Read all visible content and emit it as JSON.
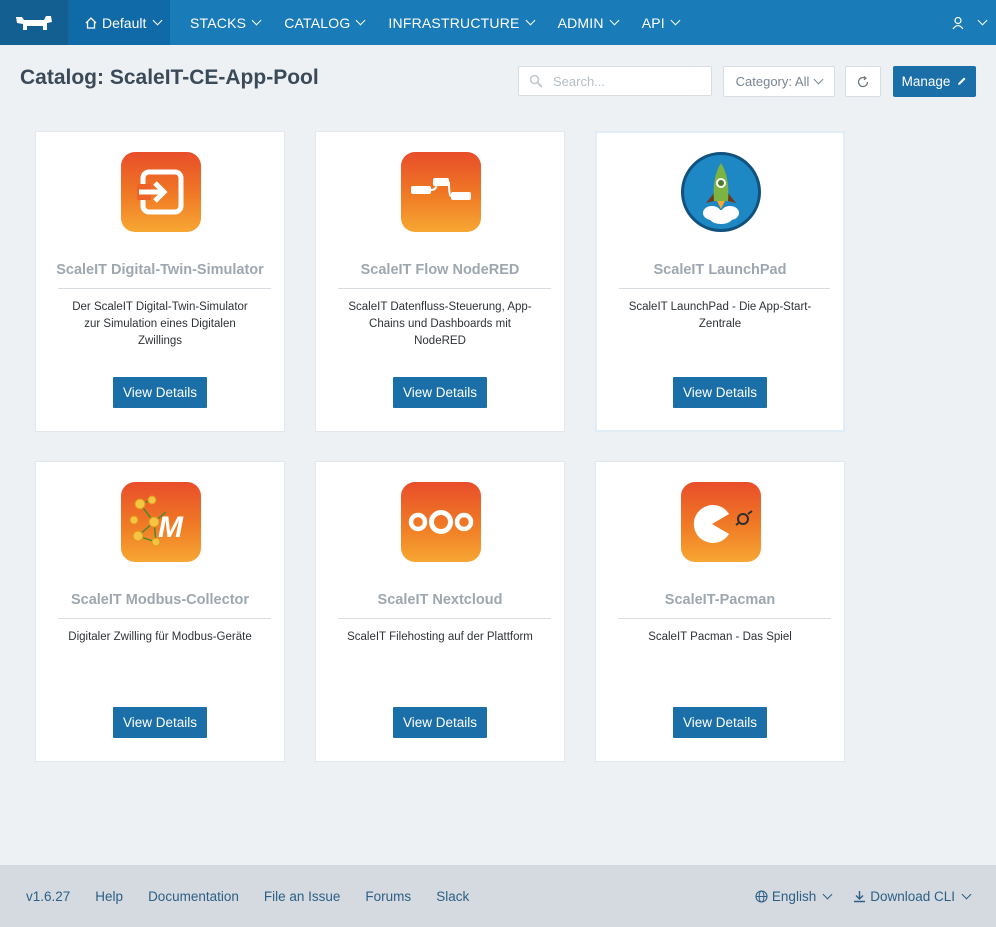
{
  "nav": {
    "environment": "Default",
    "items": [
      {
        "label": "STACKS"
      },
      {
        "label": "CATALOG"
      },
      {
        "label": "INFRASTRUCTURE"
      },
      {
        "label": "ADMIN"
      },
      {
        "label": "API"
      }
    ]
  },
  "header": {
    "title": "Catalog: ScaleIT-CE-App-Pool",
    "search_placeholder": "Search...",
    "category_label": "Category: All",
    "manage_label": "Manage"
  },
  "cards": [
    {
      "title": "ScaleIT Digital-Twin-Simulator",
      "description": "Der ScaleIT Digital-Twin-Simulator zur Simulation eines Digitalen Zwillings",
      "button": "View Details",
      "icon": "login-arrow-icon"
    },
    {
      "title": "ScaleIT Flow NodeRED",
      "description": "ScaleIT Datenfluss-Steuerung, App-Chains und Dashboards mit NodeRED",
      "button": "View Details",
      "icon": "node-red-flow-icon"
    },
    {
      "title": "ScaleIT LaunchPad",
      "description": "ScaleIT LaunchPad - Die App-Start-Zentrale",
      "button": "View Details",
      "icon": "rocket-icon"
    },
    {
      "title": "ScaleIT Modbus-Collector",
      "description": "Digitaler Zwilling für Modbus-Geräte",
      "button": "View Details",
      "icon": "modbus-network-icon"
    },
    {
      "title": "ScaleIT Nextcloud",
      "description": "ScaleIT Filehosting auf der Plattform",
      "button": "View Details",
      "icon": "nextcloud-icon"
    },
    {
      "title": "ScaleIT-Pacman",
      "description": "ScaleIT Pacman - Das Spiel",
      "button": "View Details",
      "icon": "pacman-icon"
    }
  ],
  "footer": {
    "version": "v1.6.27",
    "links": [
      "Help",
      "Documentation",
      "File an Issue",
      "Forums",
      "Slack"
    ],
    "language": "English",
    "download": "Download CLI"
  },
  "colors": {
    "nav_bg": "#1a7bb9",
    "primary_button": "#1a6fa8",
    "page_bg": "#eef1f4",
    "footer_bg": "#d4dadf"
  }
}
